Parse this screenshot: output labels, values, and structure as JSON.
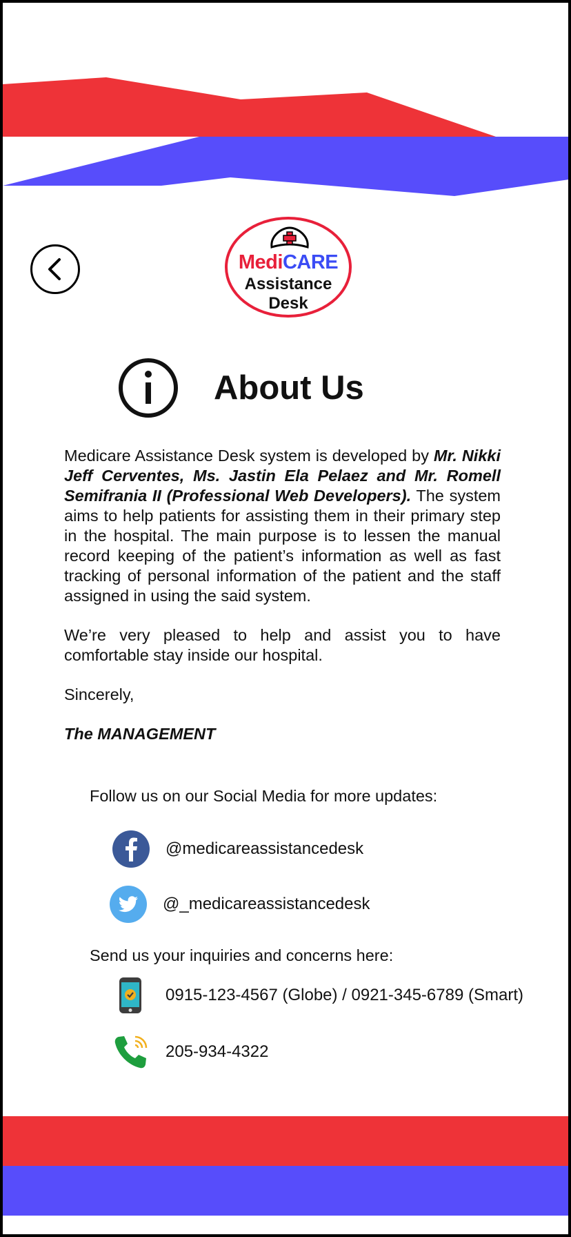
{
  "header": {
    "back_label": "",
    "logo": {
      "line1_part1": "Medi",
      "line1_part2": "CARE",
      "line2": "Assistance",
      "line3": "Desk"
    }
  },
  "page": {
    "title": "About Us"
  },
  "about": {
    "p1_intro": "Medicare Assistance Desk system is developed by ",
    "p1_developers": "Mr. Nikki Jeff Cerventes, Ms. Jastin Ela Pelaez and Mr. Romell Semifrania II (Professional Web Developers).",
    "p1_rest": " The system aims to  help patients for assisting them in their primary step in the hospital. The main purpose is to lessen the manual record keeping of the patient’s information as well as fast tracking of personal information of the patient and the staff assigned in using the said system.",
    "p2": "We’re very pleased to help and assist you to have comfortable stay inside our hospital.",
    "closing": "Sincerely,",
    "signature": "The MANAGEMENT"
  },
  "social": {
    "heading": "Follow us on our Social Media for more updates:",
    "items": [
      {
        "icon": "facebook-icon",
        "handle": "@medicareassistancedesk"
      },
      {
        "icon": "twitter-icon",
        "handle": "@_medicareassistancedesk"
      }
    ]
  },
  "contact": {
    "heading": "Send us your inquiries and concerns here:",
    "mobile": "0915-123-4567 (Globe) / 0921-345-6789 (Smart)",
    "landline": "205-934-4322"
  },
  "colors": {
    "brand_red": "#ee3338",
    "brand_blue": "#574dfb",
    "facebook": "#3b5998",
    "twitter": "#55acee",
    "phone_green": "#1e9e3e"
  }
}
